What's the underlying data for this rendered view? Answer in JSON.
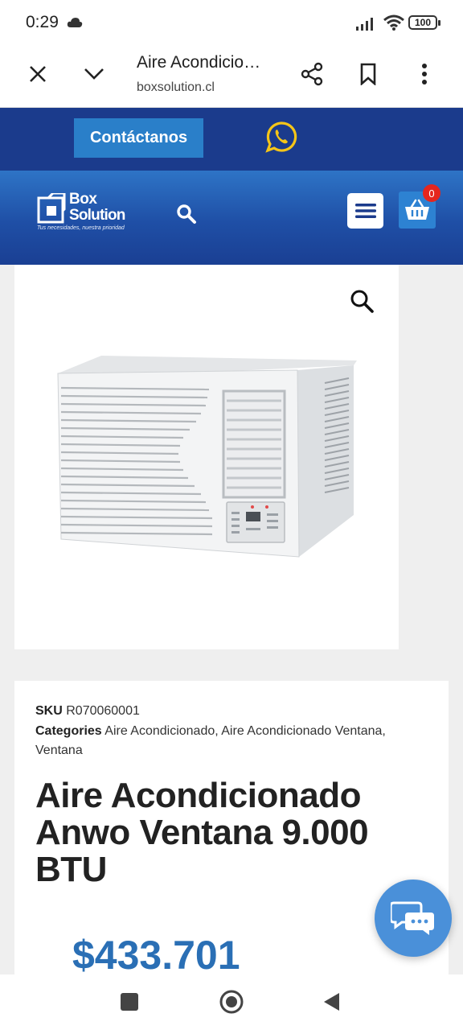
{
  "status": {
    "time": "0:29",
    "battery": "100"
  },
  "browser": {
    "page_title": "Aire Acondicio…",
    "host": "boxsolution.cl"
  },
  "header": {
    "contact_label": "Contáctanos",
    "logo_line1": "Box",
    "logo_line2": "Solution",
    "logo_tagline": "Tus necesidades, nuestra prioridad",
    "cart_count": "0"
  },
  "product": {
    "sku_label": "SKU",
    "sku_value": "R070060001",
    "categories_label": "Categories",
    "categories_value": "Aire Acondicionado, Aire Acondicionado Ventana, Ventana",
    "title": "Aire Acondicionado Anwo Ventana 9.000 BTU",
    "price": "$433.701"
  },
  "colors": {
    "header_dark": "#1b3b8c",
    "button_blue": "#2a7fc9",
    "whatsapp_yellow": "#f5c518",
    "badge_red": "#e5251d",
    "price_blue": "#2a6fb5"
  }
}
